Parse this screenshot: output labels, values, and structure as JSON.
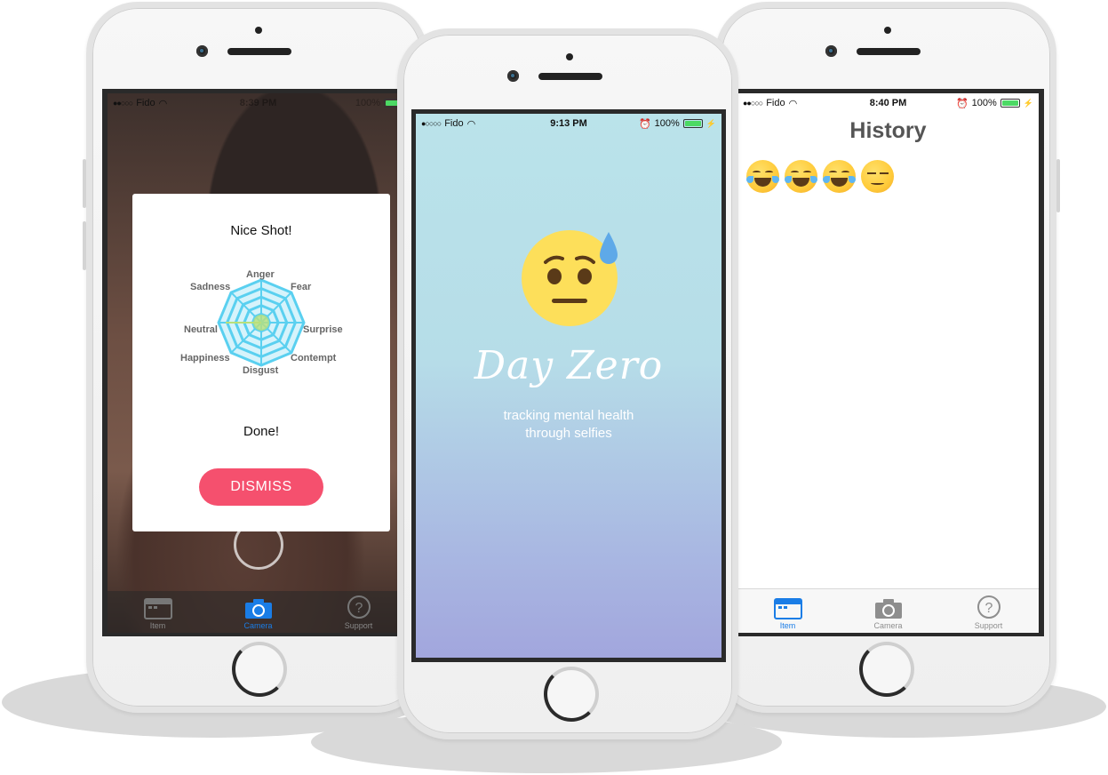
{
  "phones": {
    "camera": {
      "status": {
        "carrier": "Fido",
        "time": "8:39 PM",
        "battery": "100%"
      },
      "modal": {
        "title": "Nice Shot!",
        "done_text": "Done!",
        "dismiss_label": "DISMISS"
      },
      "radar_labels": [
        "Anger",
        "Fear",
        "Surprise",
        "Contempt",
        "Disgust",
        "Happiness",
        "Neutral",
        "Sadness"
      ],
      "tabs": [
        {
          "label": "Item",
          "icon": "item-icon"
        },
        {
          "label": "Camera",
          "icon": "camera-icon"
        },
        {
          "label": "Support",
          "icon": "question-icon"
        }
      ],
      "active_tab": "Camera"
    },
    "splash": {
      "status": {
        "carrier": "Fido",
        "time": "9:13 PM",
        "battery": "100%"
      },
      "brand": "Day Zero",
      "tagline_line1": "tracking mental health",
      "tagline_line2": "through selfies"
    },
    "history": {
      "status": {
        "carrier": "Fido",
        "time": "8:40 PM",
        "battery": "100%"
      },
      "title": "History",
      "entries": [
        "tears-of-joy",
        "tears-of-joy",
        "tears-of-joy",
        "unamused"
      ],
      "tabs": [
        {
          "label": "Item",
          "icon": "item-icon"
        },
        {
          "label": "Camera",
          "icon": "camera-icon"
        },
        {
          "label": "Support",
          "icon": "question-icon"
        }
      ],
      "active_tab": "Item"
    }
  },
  "colors": {
    "accent_blue": "#1a7de6",
    "dismiss_pink": "#f5506e",
    "radar_cyan": "#5ad0f0",
    "splash_top": "#bae3ea",
    "splash_bottom": "#a2a6dd"
  }
}
